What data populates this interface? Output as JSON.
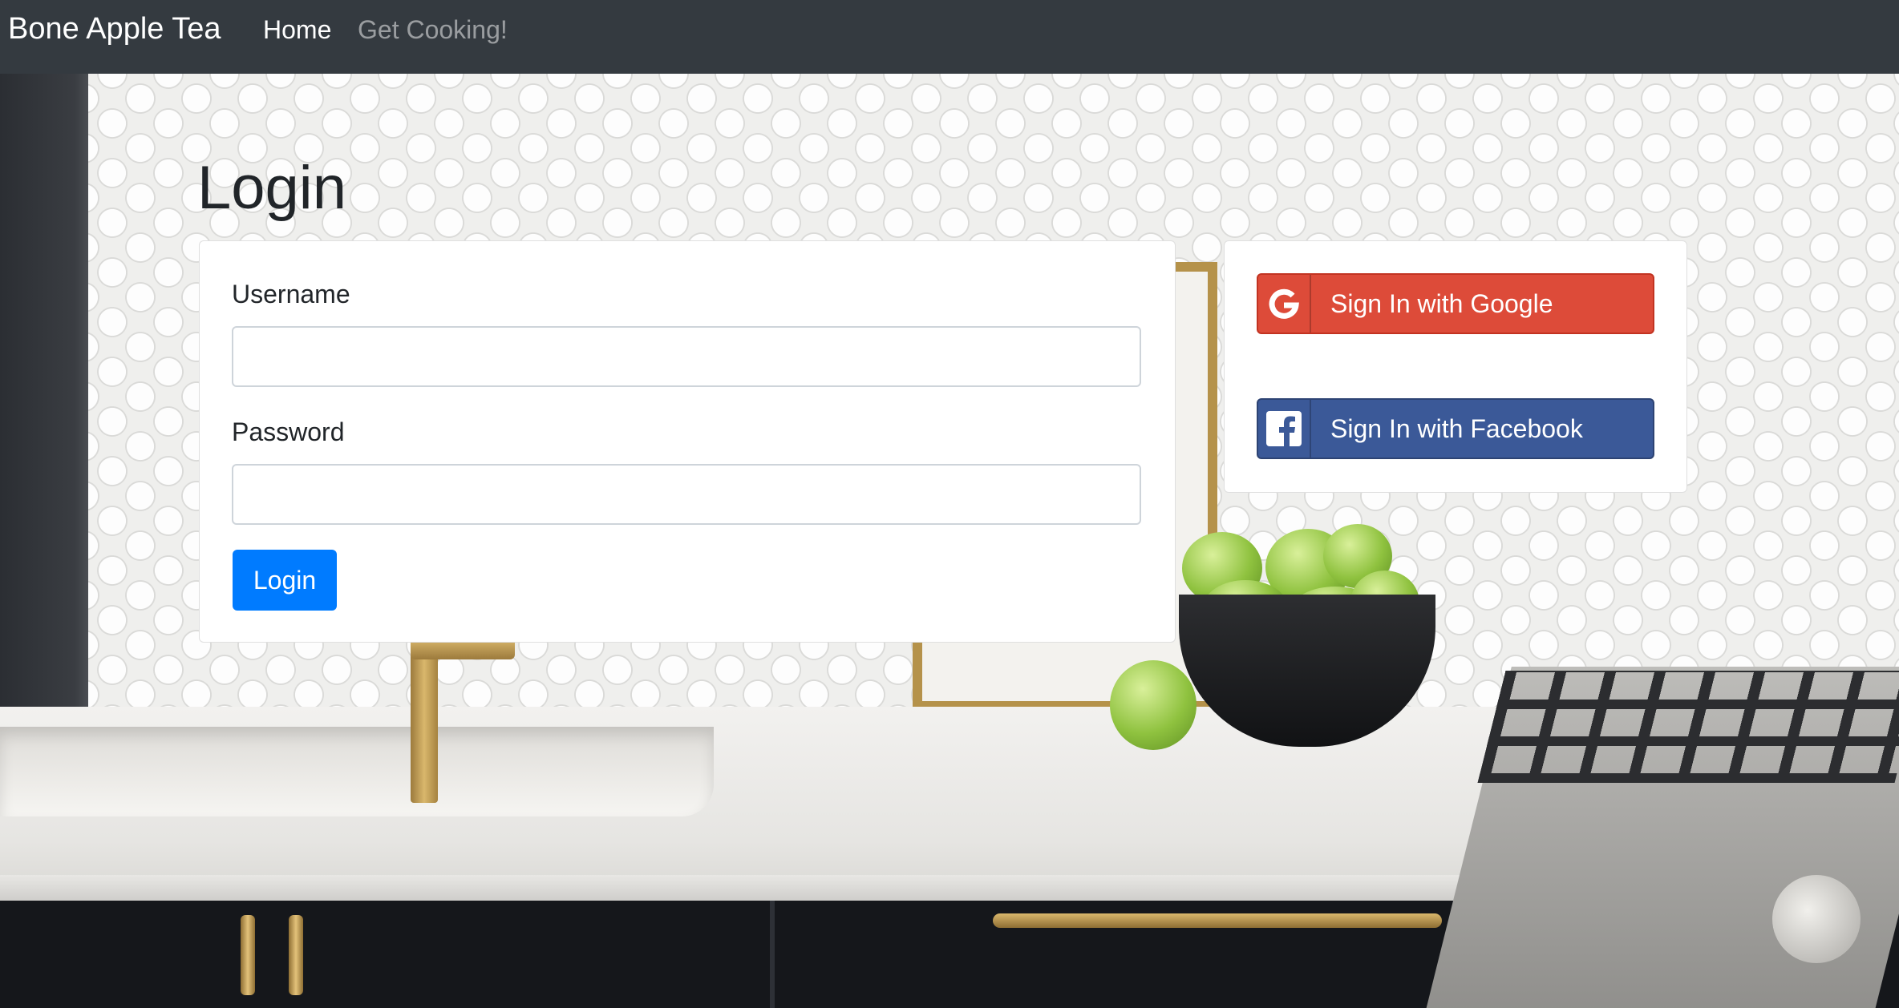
{
  "navbar": {
    "brand": "Bone Apple Tea",
    "links": [
      {
        "label": "Home",
        "active": true
      },
      {
        "label": "Get Cooking!",
        "active": false
      }
    ]
  },
  "page": {
    "title": "Login"
  },
  "login_form": {
    "username_label": "Username",
    "username_value": "",
    "password_label": "Password",
    "password_value": "",
    "submit_label": "Login"
  },
  "social": {
    "google_label": "Sign In with Google",
    "facebook_label": "Sign In with Facebook",
    "google_icon": "google-g-icon",
    "facebook_icon": "facebook-f-icon"
  },
  "colors": {
    "navbar_bg": "#343a40",
    "primary": "#007bff",
    "google": "#dd4b39",
    "facebook": "#3b5998"
  }
}
